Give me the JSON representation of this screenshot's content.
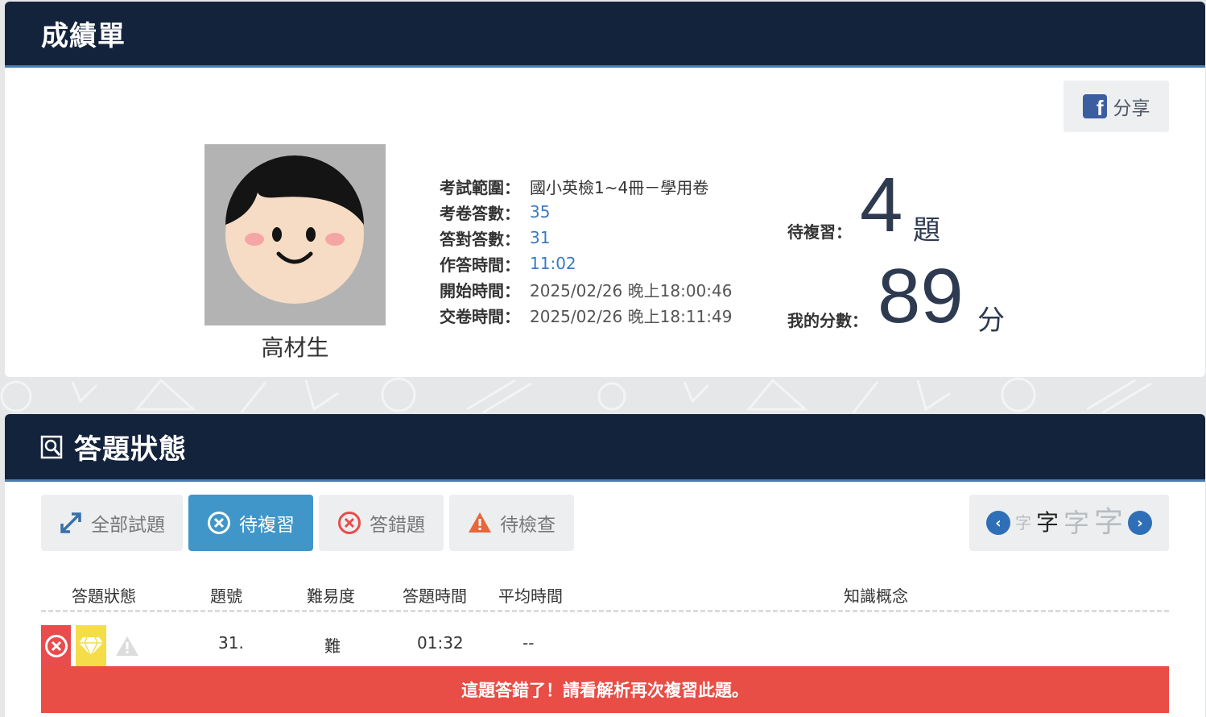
{
  "report": {
    "title": "成績單",
    "share_label": "分享",
    "avatar_name": "高材生",
    "info": [
      {
        "label": "考試範圍：",
        "value": "國小英檢1~4冊－學用卷"
      },
      {
        "label": "考卷答數：",
        "value": "35"
      },
      {
        "label": "答對答數：",
        "value": "31"
      },
      {
        "label": "作答時間：",
        "value": "11:02"
      },
      {
        "label": "開始時間：",
        "value": "2025/02/26 晚上18:00:46"
      },
      {
        "label": "交卷時間：",
        "value": "2025/02/26 晚上18:11:49"
      }
    ],
    "pending_label": "待複習：",
    "pending_value": "4",
    "pending_unit": "題",
    "score_label": "我的分數：",
    "score_value": "89",
    "score_unit": "分"
  },
  "status": {
    "title": "答題狀態",
    "tabs": [
      {
        "label": "全部試題",
        "icon": "expand-icon"
      },
      {
        "label": "待複習",
        "icon": "x-circle-icon"
      },
      {
        "label": "答錯題",
        "icon": "x-circle-red-icon"
      },
      {
        "label": "待檢查",
        "icon": "warning-icon"
      }
    ],
    "font_size_glyph": "字",
    "columns": [
      "答題狀態",
      "題號",
      "難易度",
      "答題時間",
      "平均時間",
      "知識概念"
    ],
    "rows": [
      {
        "number": "31.",
        "difficulty": "難",
        "answer_time": "01:32",
        "avg_time": "--",
        "concept": ""
      }
    ],
    "alert": "這題答錯了！請看解析再次複習此題。"
  },
  "colors": {
    "header": "#14233c",
    "active_tab": "#4096c8",
    "wrong": "#e84c4c",
    "gem": "#f4dd49"
  }
}
